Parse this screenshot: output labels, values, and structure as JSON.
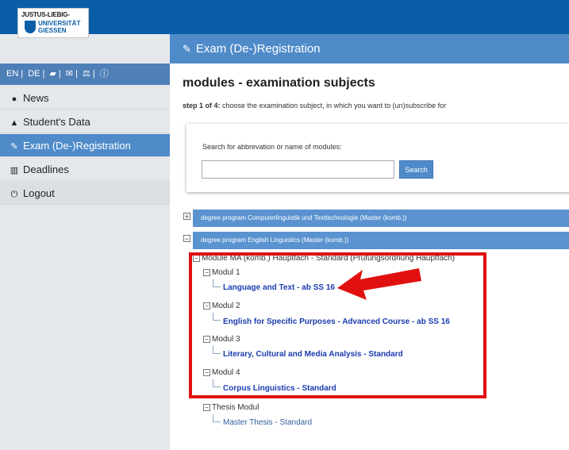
{
  "logo": {
    "line1": "JUSTUS-LIEBIG-",
    "line2": "UNIVERSITÄT",
    "line3": "GIESSEN"
  },
  "sidebar": {
    "lang_items": [
      "EN",
      "DE"
    ],
    "items": [
      {
        "label": "News",
        "icon": "comment-icon"
      },
      {
        "label": "Student's Data",
        "icon": "graduation-cap-icon"
      },
      {
        "label": "Exam (De-)Registration",
        "icon": "edit-icon"
      },
      {
        "label": "Deadlines",
        "icon": "institution-icon"
      },
      {
        "label": "Logout",
        "icon": "power-icon"
      }
    ]
  },
  "header": {
    "title": "Exam (De-)Registration"
  },
  "main": {
    "heading": "modules - examination subjects",
    "step_bold": "step 1 of 4:",
    "step_text": "choose the examination subject, in which you want to (un)subscribe for",
    "search": {
      "label": "Search for abbrevation or name of modules:",
      "value": "",
      "placeholder": "",
      "button": "Search"
    },
    "programs": [
      {
        "label": "degree program Computerlinguistik und Texttechnologie (Master (komb.))",
        "toggle": "+"
      },
      {
        "label": "degree program English Linguistics (Master (komb.))",
        "toggle": "−"
      }
    ],
    "tree": {
      "root": "Module MA (komb.) Hauptfach - Standard (Prüfungsordnung Hauptfach)",
      "modules": [
        {
          "name": "Modul 1",
          "leaf": "Language and Text - ab SS 16"
        },
        {
          "name": "Modul 2",
          "leaf": "English for Specific Purposes - Advanced Course - ab SS 16"
        },
        {
          "name": "Modul 3",
          "leaf": "Literary, Cultural and Media Analysis - Standard"
        },
        {
          "name": "Modul 4",
          "leaf": "Corpus Linguistics - Standard"
        },
        {
          "name": "Thesis Modul",
          "leaf": "Master Thesis - Standard"
        }
      ]
    }
  },
  "colors": {
    "topbar": "#0c5da8",
    "accent": "#4f8bc9",
    "highlight_box": "#e01010"
  }
}
